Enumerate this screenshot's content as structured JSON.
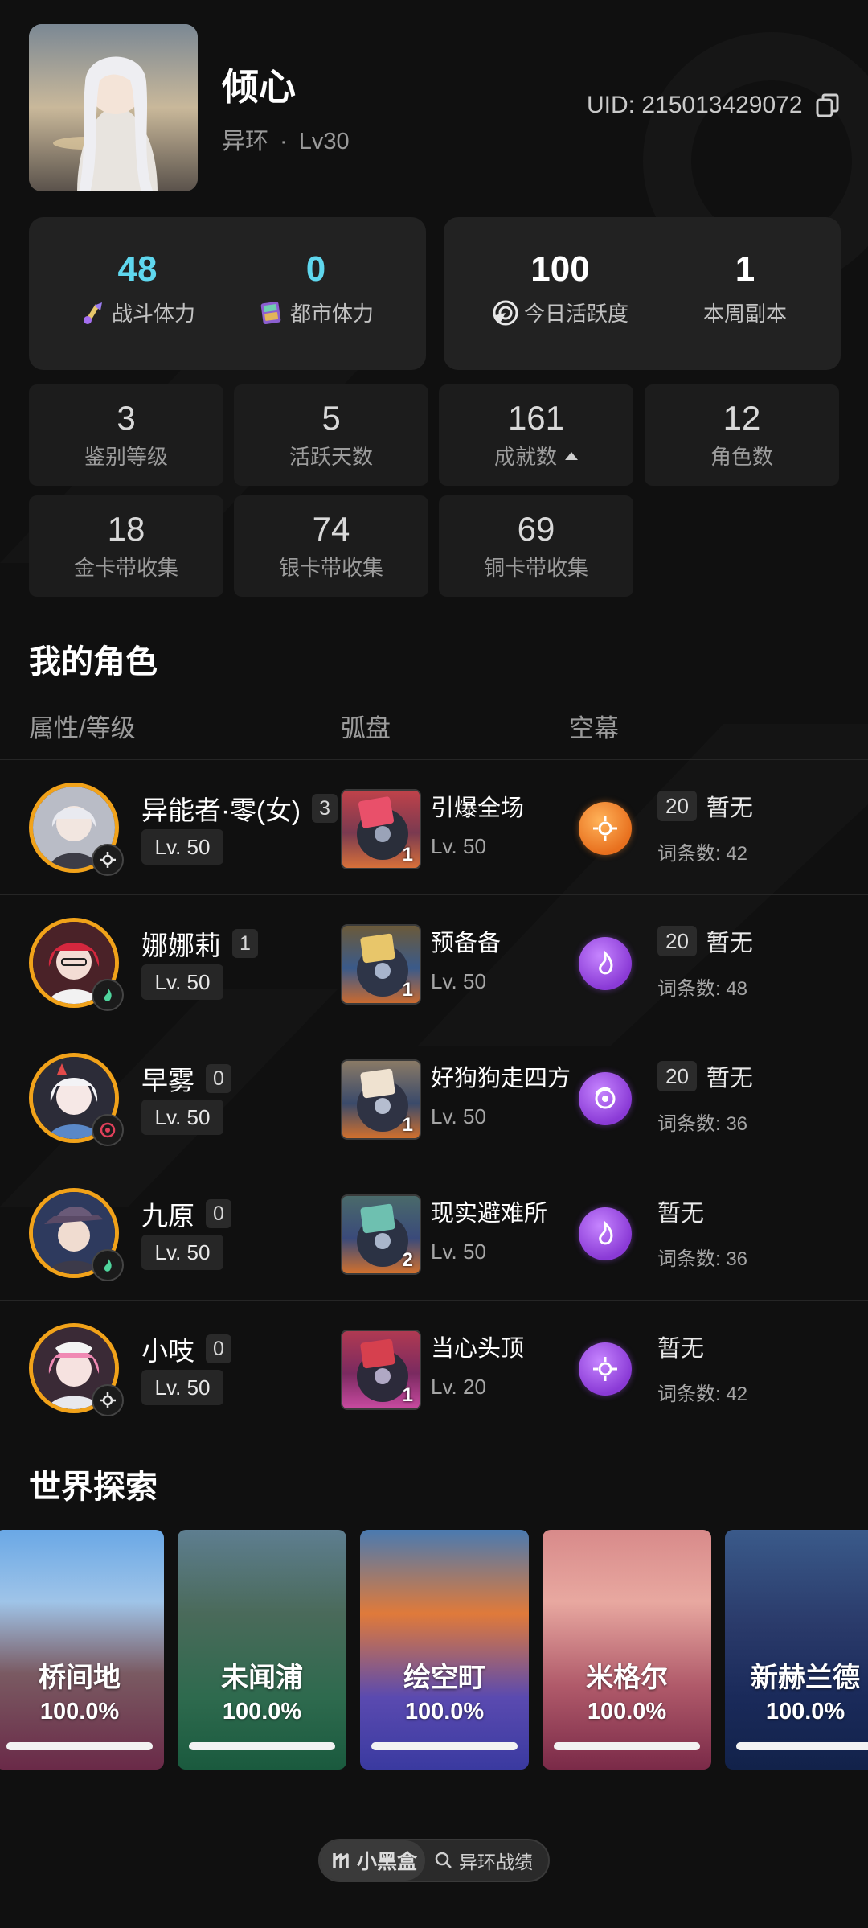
{
  "profile": {
    "name": "倾心",
    "game": "异环",
    "level": "Lv30",
    "uid": "UID: 215013429072"
  },
  "top_stats": [
    {
      "value": "48",
      "label": "战斗体力",
      "icon": "battle-stamina-icon",
      "color": "#5fd7ee"
    },
    {
      "value": "0",
      "label": "都市体力",
      "icon": "city-stamina-icon",
      "color": "#5fd7ee"
    },
    {
      "value": "100",
      "label": "今日活跃度",
      "icon": "activity-icon"
    },
    {
      "value": "1",
      "label": "本周副本"
    }
  ],
  "small_stats": [
    {
      "value": "3",
      "label": "鉴别等级"
    },
    {
      "value": "5",
      "label": "活跃天数"
    },
    {
      "value": "161",
      "label": "成就数"
    },
    {
      "value": "12",
      "label": "角色数"
    },
    {
      "value": "18",
      "label": "金卡带收集"
    },
    {
      "value": "74",
      "label": "银卡带收集"
    },
    {
      "value": "69",
      "label": "铜卡带收集"
    }
  ],
  "characters_section": {
    "title": "我的角色",
    "headers": [
      "属性/等级",
      "弧盘",
      "空幕"
    ],
    "rows": [
      {
        "name": "异能者·零(女)",
        "badge": "3",
        "level": "Lv. 50",
        "disc_name": "引爆全场",
        "disc_count": "1",
        "disc_level": "Lv. 50",
        "orb": "orange",
        "kong_badge": "20",
        "kong_value": "暂无",
        "entries": "词条数: 42"
      },
      {
        "name": "娜娜莉",
        "badge": "1",
        "level": "Lv. 50",
        "disc_name": "预备备",
        "disc_count": "1",
        "disc_level": "Lv. 50",
        "orb": "purple",
        "kong_badge": "20",
        "kong_value": "暂无",
        "entries": "词条数: 48"
      },
      {
        "name": "早雾",
        "badge": "0",
        "level": "Lv. 50",
        "disc_name": "好狗狗走四方",
        "disc_count": "1",
        "disc_level": "Lv. 50",
        "orb": "purple",
        "kong_badge": "20",
        "kong_value": "暂无",
        "entries": "词条数: 36"
      },
      {
        "name": "九原",
        "badge": "0",
        "level": "Lv. 50",
        "disc_name": "现实避难所",
        "disc_count": "2",
        "disc_level": "Lv. 50",
        "orb": "purple",
        "kong_badge": "",
        "kong_value": "暂无",
        "entries": "词条数: 36"
      },
      {
        "name": "小吱",
        "badge": "0",
        "level": "Lv. 50",
        "disc_name": "当心头顶",
        "disc_count": "1",
        "disc_level": "Lv. 20",
        "orb": "purple",
        "kong_badge": "",
        "kong_value": "暂无",
        "entries": "词条数: 42"
      }
    ]
  },
  "explore_section": {
    "title": "世界探索",
    "areas": [
      {
        "name": "桥间地",
        "percent": "100.0%",
        "progress": 1.0
      },
      {
        "name": "未闻浦",
        "percent": "100.0%",
        "progress": 1.0
      },
      {
        "name": "绘空町",
        "percent": "100.0%",
        "progress": 1.0
      },
      {
        "name": "米格尔",
        "percent": "100.0%",
        "progress": 1.0
      },
      {
        "name": "新赫兰德",
        "percent": "100.0%",
        "progress": 1.0
      }
    ]
  },
  "footer": {
    "brand": "小黑盒",
    "query": "异环战绩"
  },
  "colors": {
    "accent_cyan": "#5fd7ee",
    "avatar_ring": "#f1a21a",
    "background": "#101010"
  }
}
